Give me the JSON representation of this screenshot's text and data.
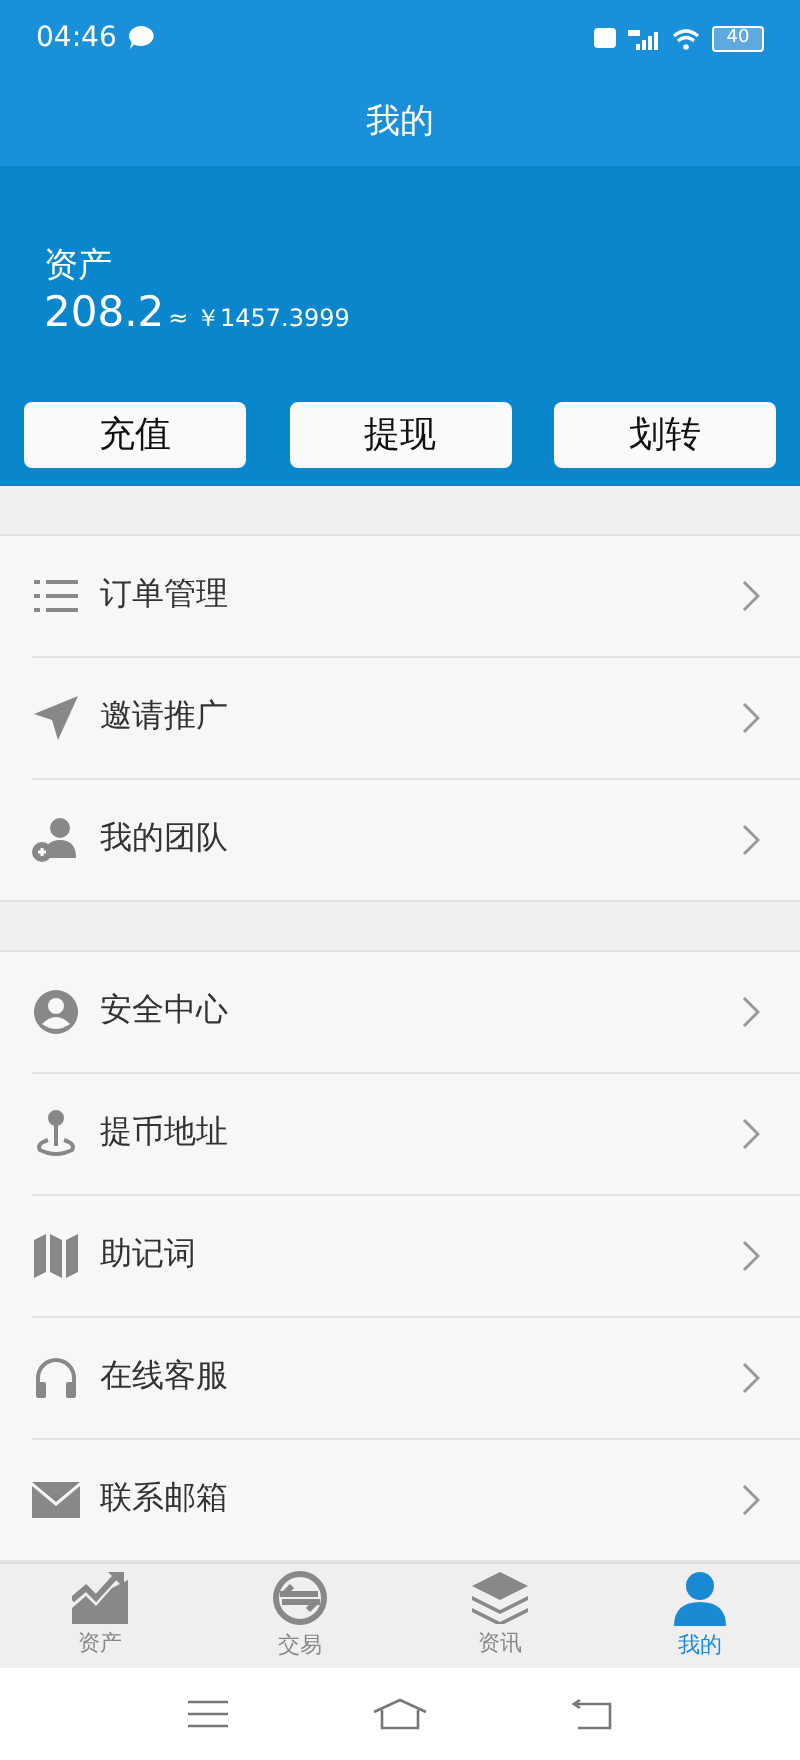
{
  "status_bar": {
    "time": "04:46",
    "battery": "40"
  },
  "title": "我的",
  "assets": {
    "label": "资产",
    "amount": "208.2",
    "approx": "≈ ￥1457.3999"
  },
  "actions": [
    "充值",
    "提现",
    "划转"
  ],
  "menu_groups": [
    [
      {
        "label": "订单管理"
      },
      {
        "label": "邀请推广"
      },
      {
        "label": "我的团队"
      }
    ],
    [
      {
        "label": "安全中心"
      },
      {
        "label": "提币地址"
      },
      {
        "label": "助记词"
      },
      {
        "label": "在线客服"
      },
      {
        "label": "联系邮箱"
      }
    ]
  ],
  "tabs": [
    {
      "label": "资产",
      "selected": false
    },
    {
      "label": "交易",
      "selected": false
    },
    {
      "label": "资讯",
      "selected": false
    },
    {
      "label": "我的",
      "selected": true
    }
  ]
}
